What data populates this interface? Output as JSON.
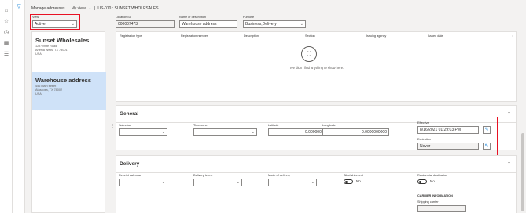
{
  "left_rail": {
    "icons": [
      "home-icon",
      "star-icon",
      "clock-icon",
      "grid-icon",
      "list-icon"
    ]
  },
  "filter_icon": "filter-icon",
  "breadcrumb": {
    "part1": "Manage addresses",
    "sep1": "|",
    "part2": "My view",
    "chev": "⌄",
    "sep2": "|",
    "part3": "US-010 : SUNSET WHOLESALES"
  },
  "view": {
    "label": "View",
    "value": "Active"
  },
  "header_fields": {
    "location_id": {
      "label": "Location ID",
      "value": "000007473"
    },
    "name": {
      "label": "Name or description",
      "value": "Warehouse address"
    },
    "purpose": {
      "label": "Purpose",
      "value": "Business;Delivery"
    }
  },
  "addresses": [
    {
      "name": "Sunset Wholesales",
      "lines": [
        "123 White Road",
        "Artesia Wells, TX 78001",
        "USA"
      ]
    },
    {
      "name": "Warehouse address",
      "lines": [
        "456 Main street",
        "Atascosa, TX 78002",
        "USA"
      ]
    }
  ],
  "grid": {
    "columns": [
      "Registration type",
      "Registration number",
      "Description",
      "Section",
      "Issuing agency",
      "Issued date"
    ],
    "empty_text": "We didn't find anything to show here."
  },
  "general": {
    "title": "General",
    "sales_tax": {
      "label": "Sales tax",
      "value": ""
    },
    "time_zone": {
      "label": "Time zone",
      "value": ""
    },
    "latitude": {
      "label": "Latitude",
      "value": "0.0000000000"
    },
    "longitude": {
      "label": "Longitude",
      "value": "0.0000000000"
    },
    "effective": {
      "label": "Effective",
      "value": "8/16/2021 01:29:03 PM"
    },
    "expiration": {
      "label": "Expiration",
      "value": "Never"
    }
  },
  "delivery": {
    "title": "Delivery",
    "receipt_calendar": {
      "label": "Receipt calendar",
      "value": ""
    },
    "delivery_terms": {
      "label": "Delivery terms",
      "value": ""
    },
    "mode_of_delivery": {
      "label": "Mode of delivery",
      "value": ""
    },
    "blind_shipment": {
      "label": "Blind shipment",
      "value": "No"
    },
    "residential": {
      "label": "Residential destination",
      "value": "No"
    },
    "carrier_info": "CARRIER INFORMATION",
    "shipping_carrier": {
      "label": "Shipping carrier",
      "value": ""
    }
  },
  "colors": {
    "accent": "#0078d4",
    "highlight_red": "#e81123",
    "selected_card": "#cfe2f8"
  }
}
